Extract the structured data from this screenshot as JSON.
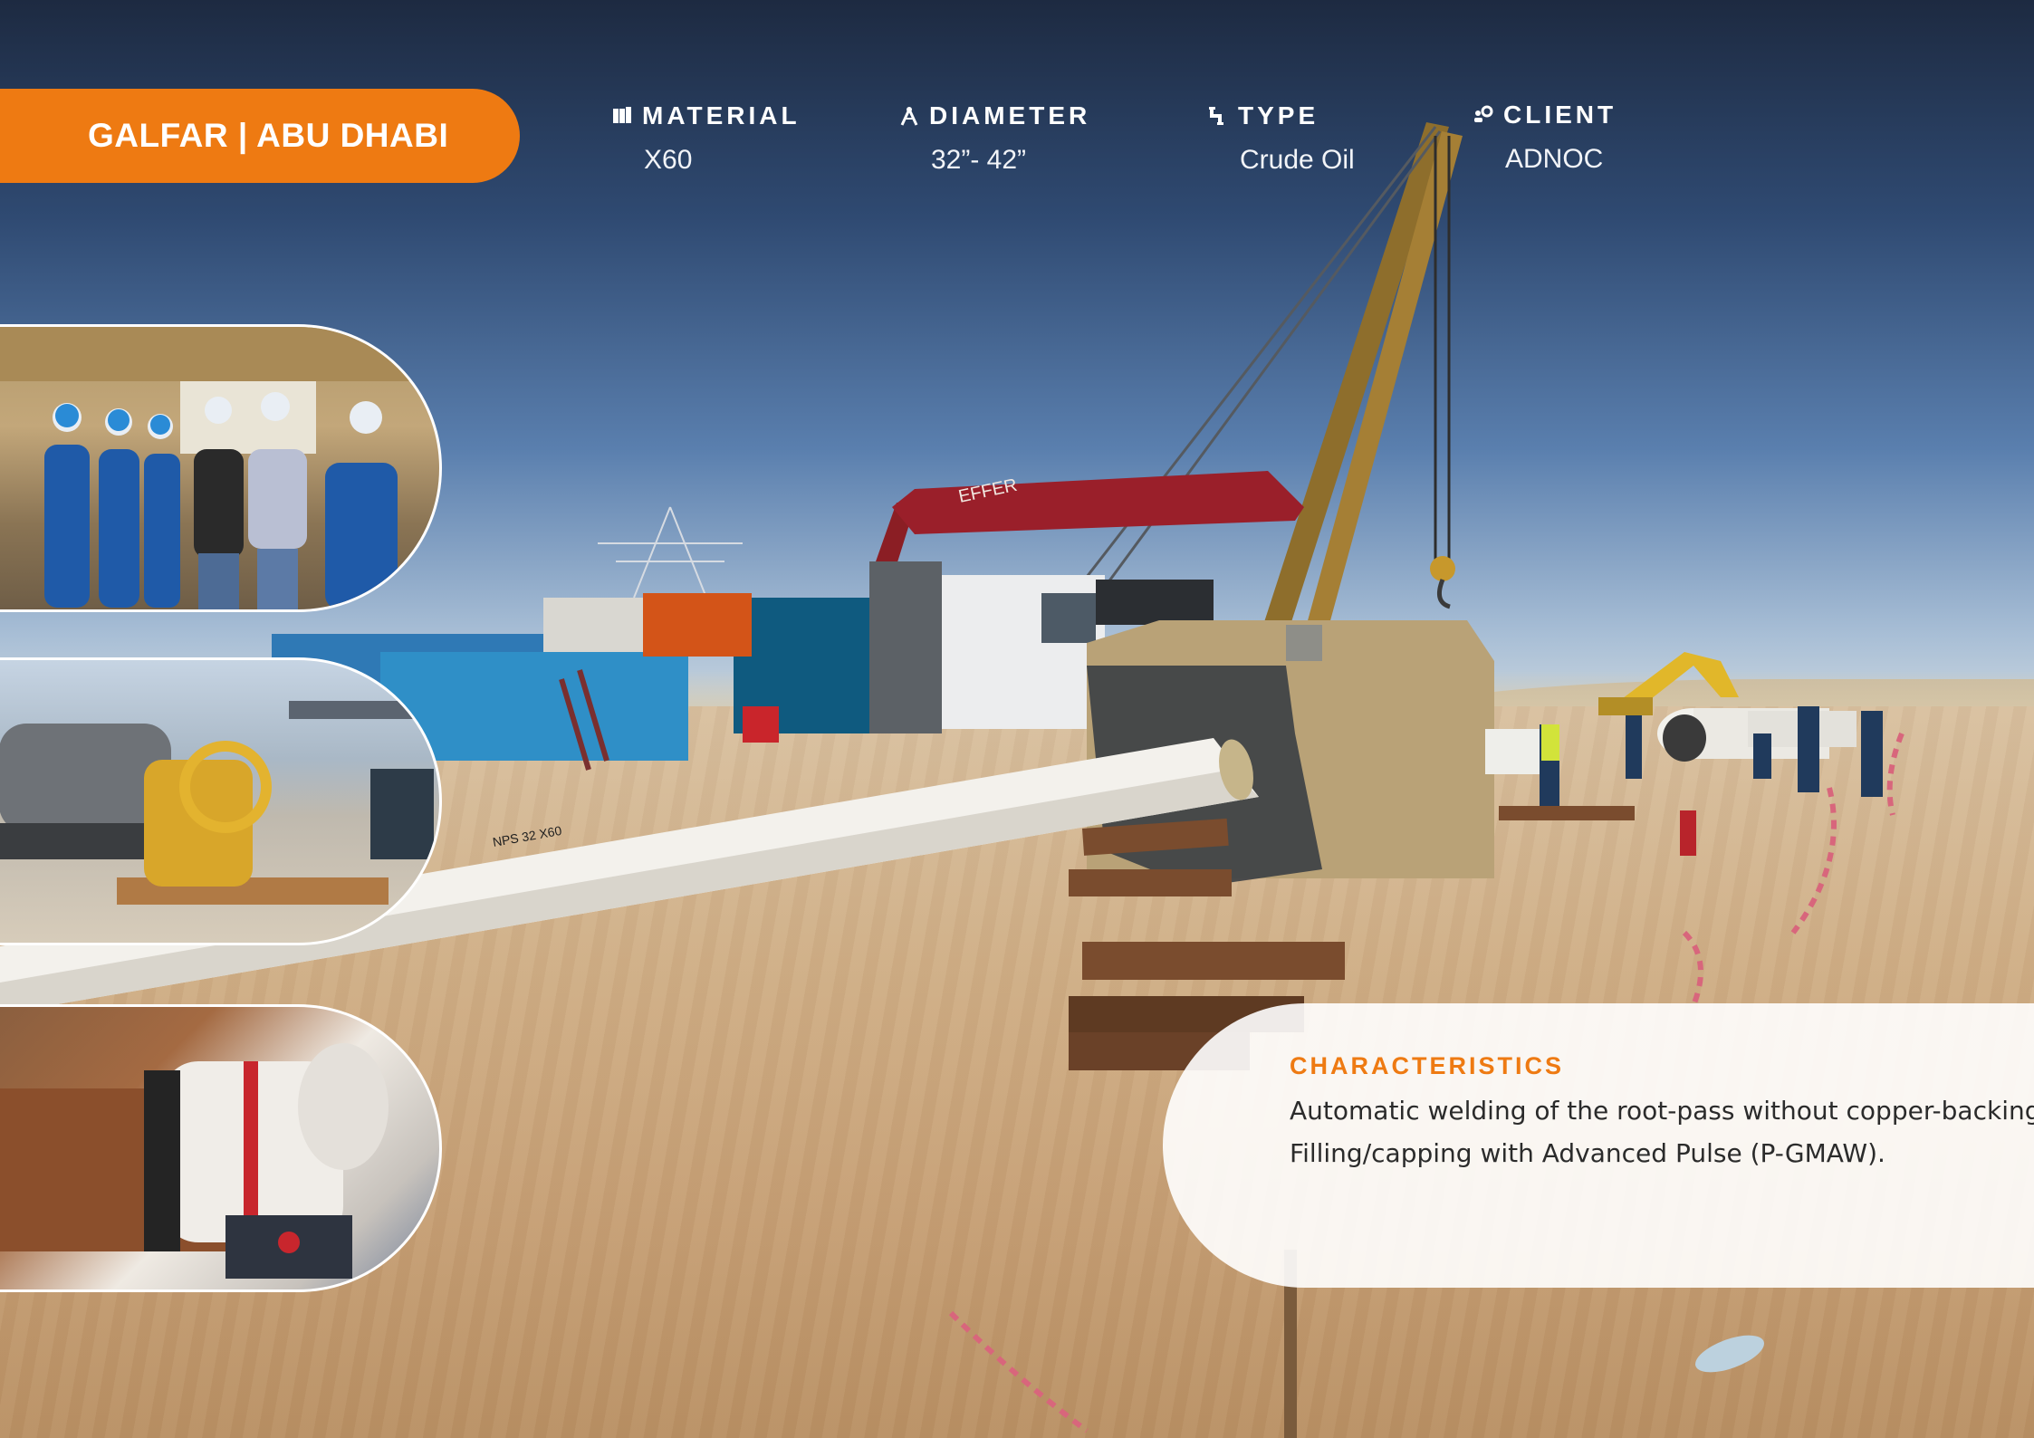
{
  "header": {
    "title": "GALFAR | ABU DHABI"
  },
  "specs": {
    "material": {
      "label": "MATERIAL",
      "value": "X60",
      "icon": "beam-icon"
    },
    "diameter": {
      "label": "DIAMETER",
      "value": "32”- 42”",
      "icon": "compass-icon"
    },
    "type": {
      "label": "TYPE",
      "value": "Crude Oil",
      "icon": "pipe-icon"
    },
    "client": {
      "label": "CLIENT",
      "value": "ADNOC",
      "icon": "handshake-icon"
    }
  },
  "characteristics": {
    "title": "CHARACTERISTICS",
    "lines": [
      "Automatic welding of the root-pass without copper-backing.",
      "Filling/capping with Advanced Pulse (P-GMAW)."
    ]
  },
  "colors": {
    "accent": "#ee7a12",
    "sky_dark": "#1d2a41",
    "sand": "#cfae86",
    "card_bg": "#ffffff"
  }
}
